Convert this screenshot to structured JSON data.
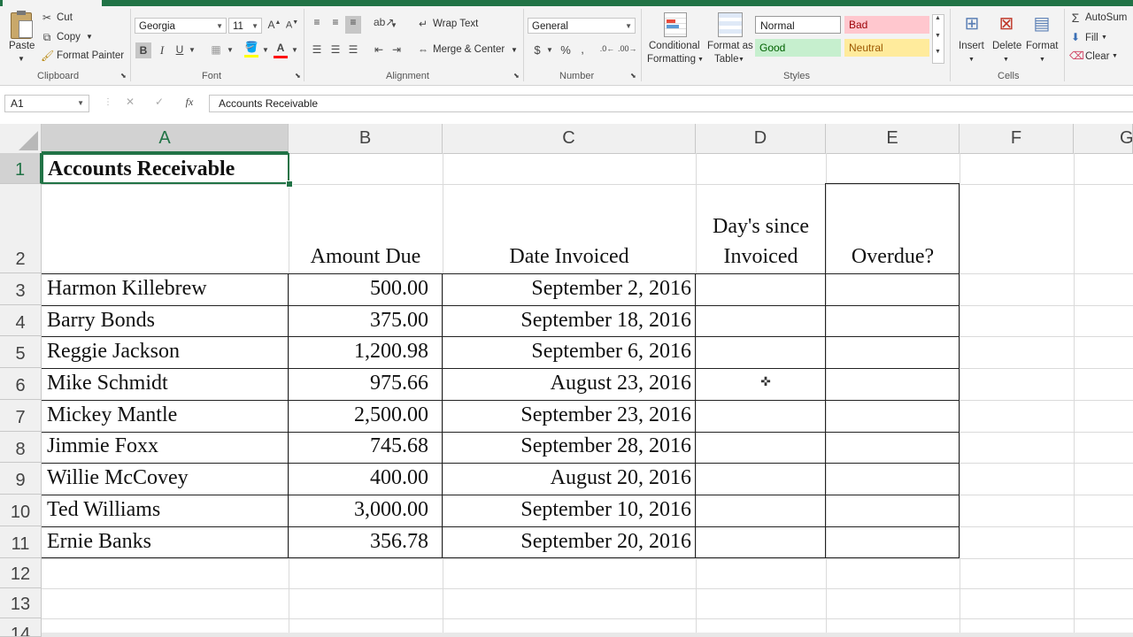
{
  "ribbon": {
    "clipboard": {
      "paste": "Paste",
      "cut": "Cut",
      "copy": "Copy",
      "format_painter": "Format Painter",
      "label": "Clipboard"
    },
    "font": {
      "name": "Georgia",
      "size": "11",
      "label": "Font"
    },
    "alignment": {
      "wrap_text": "Wrap Text",
      "merge_center": "Merge & Center",
      "label": "Alignment"
    },
    "number": {
      "format": "General",
      "label": "Number"
    },
    "styles": {
      "conditional_1": "Conditional",
      "conditional_2": "Formatting",
      "format_as_1": "Format as",
      "format_as_2": "Table",
      "normal": "Normal",
      "bad": "Bad",
      "good": "Good",
      "neutral": "Neutral",
      "label": "Styles"
    },
    "cells": {
      "insert": "Insert",
      "delete": "Delete",
      "format": "Format",
      "label": "Cells"
    },
    "editing": {
      "autosum": "AutoSum",
      "fill": "Fill",
      "clear": "Clear"
    }
  },
  "formula_bar": {
    "name_box": "A1",
    "content": "Accounts Receivable"
  },
  "columns": [
    "A",
    "B",
    "C",
    "D",
    "E",
    "F",
    "G"
  ],
  "rows": [
    "1",
    "2",
    "3",
    "4",
    "5",
    "6",
    "7",
    "8",
    "9",
    "10",
    "11",
    "12",
    "13",
    "14"
  ],
  "sheet": {
    "title": "Accounts Receivable",
    "headers": {
      "amount": "Amount Due",
      "date": "Date Invoiced",
      "days_1": "Day's since",
      "days_2": "Invoiced",
      "overdue": "Overdue?"
    },
    "records": [
      {
        "name": "Harmon Killebrew",
        "amount": "500.00",
        "date": "September 2, 2016"
      },
      {
        "name": "Barry Bonds",
        "amount": "375.00",
        "date": "September 18, 2016"
      },
      {
        "name": "Reggie Jackson",
        "amount": "1,200.98",
        "date": "September 6, 2016"
      },
      {
        "name": "Mike Schmidt",
        "amount": "975.66",
        "date": "August 23, 2016"
      },
      {
        "name": "Mickey Mantle",
        "amount": "2,500.00",
        "date": "September 23, 2016"
      },
      {
        "name": "Jimmie Foxx",
        "amount": "745.68",
        "date": "September 28, 2016"
      },
      {
        "name": "Willie McCovey",
        "amount": "400.00",
        "date": "August 20, 2016"
      },
      {
        "name": "Ted Williams",
        "amount": "3,000.00",
        "date": "September 10, 2016"
      },
      {
        "name": "Ernie Banks",
        "amount": "356.78",
        "date": "September 20, 2016"
      }
    ]
  },
  "colors": {
    "excel_green": "#217346",
    "bad_bg": "#ffc7ce",
    "bad_fg": "#9c0006",
    "good_bg": "#c6efce",
    "good_fg": "#006100",
    "neutral_bg": "#ffeb9c",
    "neutral_fg": "#9c5700"
  }
}
